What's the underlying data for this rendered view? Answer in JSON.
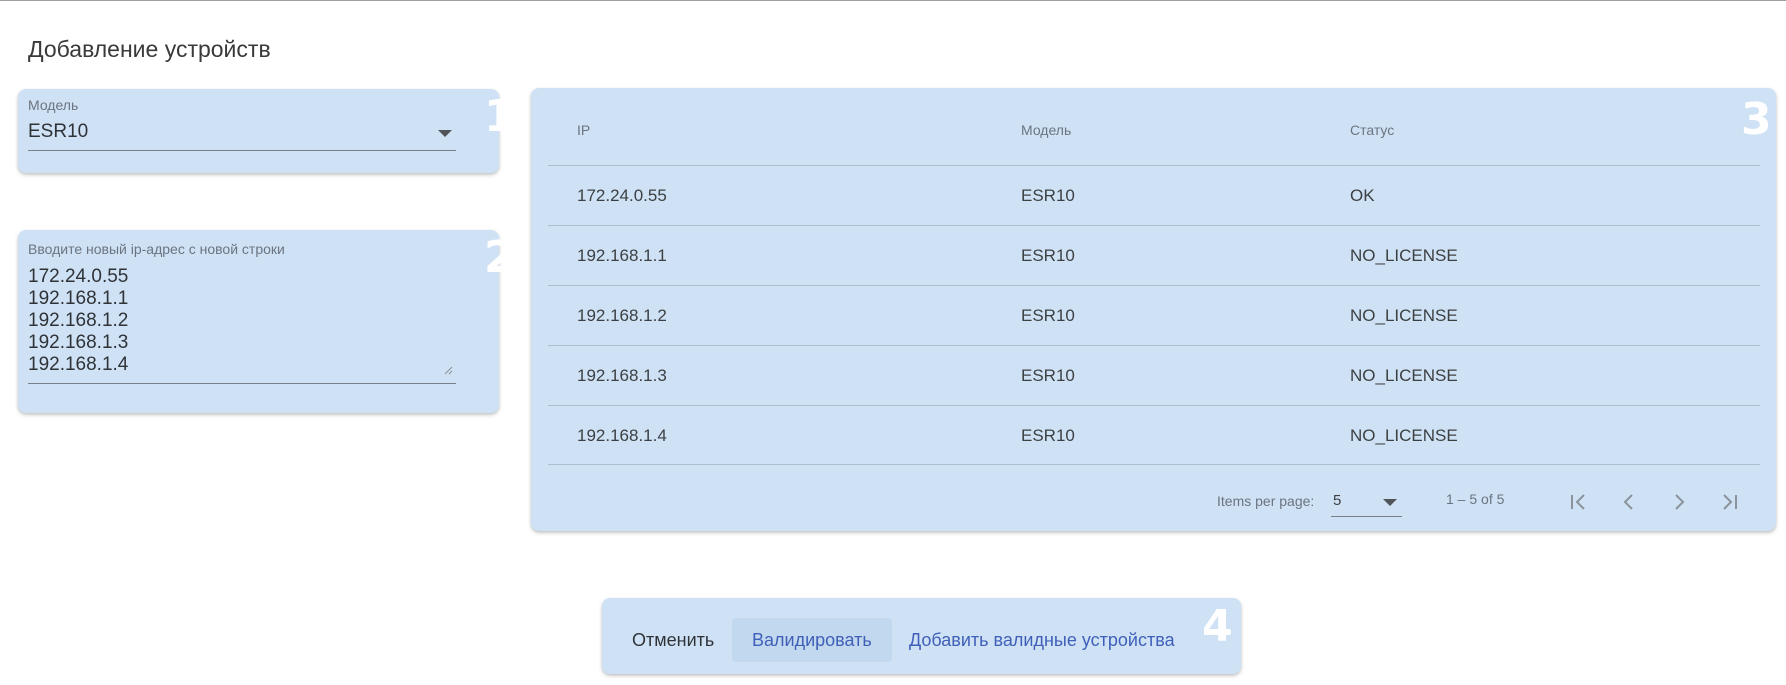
{
  "page": {
    "title": "Добавление устройств"
  },
  "model_select": {
    "label": "Модель",
    "value": "ESR10",
    "badge": "1"
  },
  "ip_input": {
    "label": "Вводите новый ip-адрес с новой строки",
    "value": "172.24.0.55\n192.168.1.1\n192.168.1.2\n192.168.1.3\n192.168.1.4",
    "badge": "2"
  },
  "table": {
    "badge": "3",
    "headers": {
      "ip": "IP",
      "model": "Модель",
      "status": "Статус"
    },
    "rows": [
      {
        "ip": "172.24.0.55",
        "model": "ESR10",
        "status": "OK"
      },
      {
        "ip": "192.168.1.1",
        "model": "ESR10",
        "status": "NO_LICENSE"
      },
      {
        "ip": "192.168.1.2",
        "model": "ESR10",
        "status": "NO_LICENSE"
      },
      {
        "ip": "192.168.1.3",
        "model": "ESR10",
        "status": "NO_LICENSE"
      },
      {
        "ip": "192.168.1.4",
        "model": "ESR10",
        "status": "NO_LICENSE"
      }
    ],
    "paginator": {
      "items_per_page_label": "Items per page:",
      "page_size": "5",
      "range": "1 – 5 of 5",
      "icons": [
        "first-page-icon",
        "previous-page-icon",
        "next-page-icon",
        "last-page-icon"
      ]
    }
  },
  "actions": {
    "badge": "4",
    "cancel": "Отменить",
    "validate": "Валидировать",
    "add_valid": "Добавить валидные устройства"
  },
  "colors": {
    "panel_bg": "#cfe2f5",
    "accent": "#3f5fb8",
    "muted_text": "#6b7480",
    "badge": "#ffffff"
  }
}
